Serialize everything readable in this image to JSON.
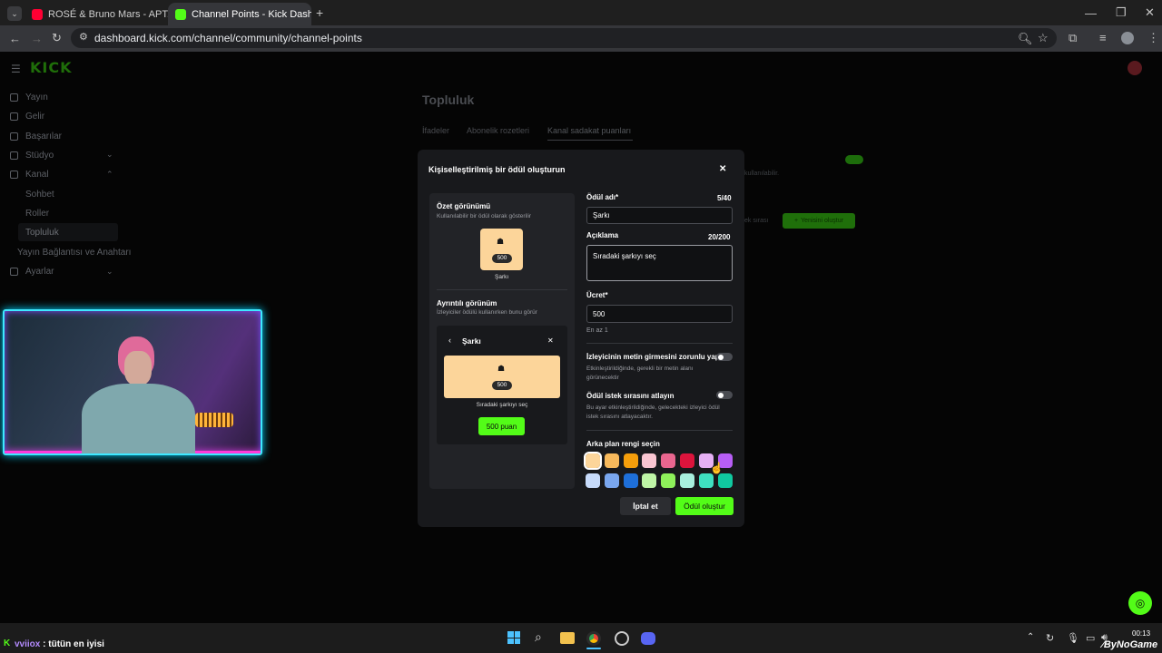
{
  "browser": {
    "tabs": [
      {
        "title": "ROSÉ & Bruno Mars - APT. (Offi",
        "active": false
      },
      {
        "title": "Channel Points - Kick Dashboa",
        "active": true
      }
    ],
    "url": "dashboard.kick.com/channel/community/channel-points"
  },
  "brand": {
    "logo": "KICK",
    "accent": "#53fc18"
  },
  "sidebar": {
    "items": [
      {
        "label": "Yayın",
        "icon": "broadcast-icon"
      },
      {
        "label": "Gelir",
        "icon": "revenue-icon"
      },
      {
        "label": "Başarılar",
        "icon": "trophy-icon"
      },
      {
        "label": "Stüdyo",
        "icon": "studio-icon"
      },
      {
        "label": "Kanal",
        "icon": "channel-icon"
      }
    ],
    "subitems": [
      "Sohbet",
      "Roller",
      "Topluluk"
    ],
    "extra": "Yayın Bağlantısı ve Anahtarı",
    "settings": "Ayarlar"
  },
  "main": {
    "title": "Topluluk",
    "tabs": [
      "İfadeler",
      "Abonelik rozetleri",
      "Kanal sadakat puanları"
    ],
    "bg_text": "kullanılabilir.",
    "bg_queue": "ek sırası",
    "bg_create": "Yenisini oluştur"
  },
  "modal": {
    "title": "Kişiselleştirilmiş bir ödül oluşturun",
    "summary_title": "Özet görünümü",
    "summary_sub": "Kullanılabilir bir ödül olarak gösterilir",
    "cost_badge": "500",
    "reward_name_preview": "Şarkı",
    "detail_title": "Ayrıntılı görünüm",
    "detail_sub": "İzleyiciler ödülü kullanırken bunu görür",
    "detail_header": "Şarkı",
    "detail_desc": "Sıradaki şarkıyı seç",
    "detail_button": "500 puan",
    "name_label": "Ödül adı*",
    "name_count": "5/40",
    "name_value": "Şarkı",
    "desc_label": "Açıklama",
    "desc_count": "20/200",
    "desc_value": "Sıradaki şarkıyı seç",
    "cost_label": "Ücret*",
    "cost_value": "500",
    "cost_hint": "En az 1",
    "toggle1_label": "İzleyicinin metin girmesini zorunlu yap",
    "toggle1_desc": "Etkinleştirildiğinde, gerekli bir metin alanı görünecektir",
    "toggle2_label": "Ödül istek sırasını atlayın",
    "toggle2_desc": "Bu ayar etkinleştirildiğinde, gelecekteki izleyici ödül istek sırasını atlayacaktır.",
    "color_label": "Arka plan rengi seçin",
    "selected_color": "#fcd59a",
    "colors_row1": [
      "#fcd59a",
      "#f7b95c",
      "#f59e0b",
      "#f9c5d1",
      "#e9668f",
      "#dc143c",
      "#e6b0f5",
      "#b75ef5"
    ],
    "colors_row2": [
      "#c7dbfa",
      "#7aa7ef",
      "#1e6fd9",
      "#bff5a6",
      "#8ef05a",
      "#a8f0de",
      "#3fe0c0",
      "#10c9a0"
    ],
    "cancel": "İptal et",
    "create": "Ödül oluştur"
  },
  "chat_overlay": {
    "user": "vviiox",
    "message": ": tütün en iyisi"
  },
  "taskbar": {
    "time": "00:13",
    "watermark": "ByNoGame"
  }
}
